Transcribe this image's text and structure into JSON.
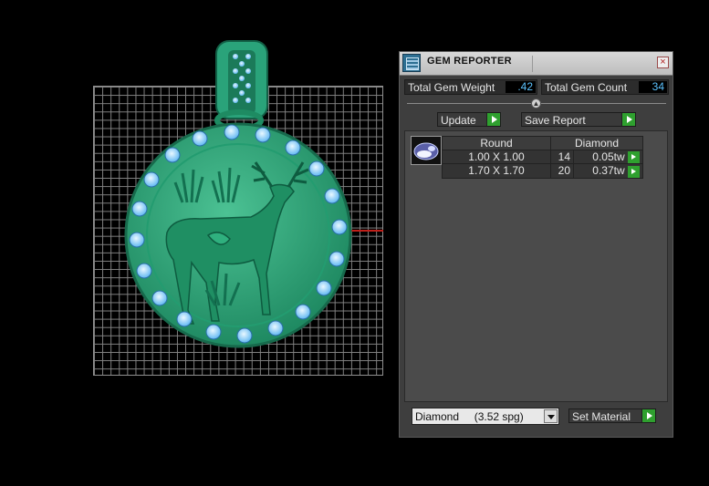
{
  "window": {
    "title": "GEM REPORTER",
    "close": "×"
  },
  "stats": {
    "weight_label": "Total Gem Weight",
    "weight_value": ".42",
    "count_label": "Total Gem Count",
    "count_value": "34"
  },
  "actions": {
    "update_label": "Update",
    "save_label": "Save Report"
  },
  "table": {
    "headers": [
      "Round",
      "Diamond"
    ],
    "rows": [
      {
        "size": "1.00 X 1.00",
        "count": "14",
        "weight": "0.05tw"
      },
      {
        "size": "1.70 X 1.70",
        "count": "20",
        "weight": "0.37tw"
      }
    ]
  },
  "material": {
    "selected": "Diamond     (3.52 spg)",
    "set_label": "Set Material"
  },
  "colors": {
    "pendant": "#2fa57a",
    "gem": "#8fd3ff",
    "accent_green": "#2fa02f"
  }
}
